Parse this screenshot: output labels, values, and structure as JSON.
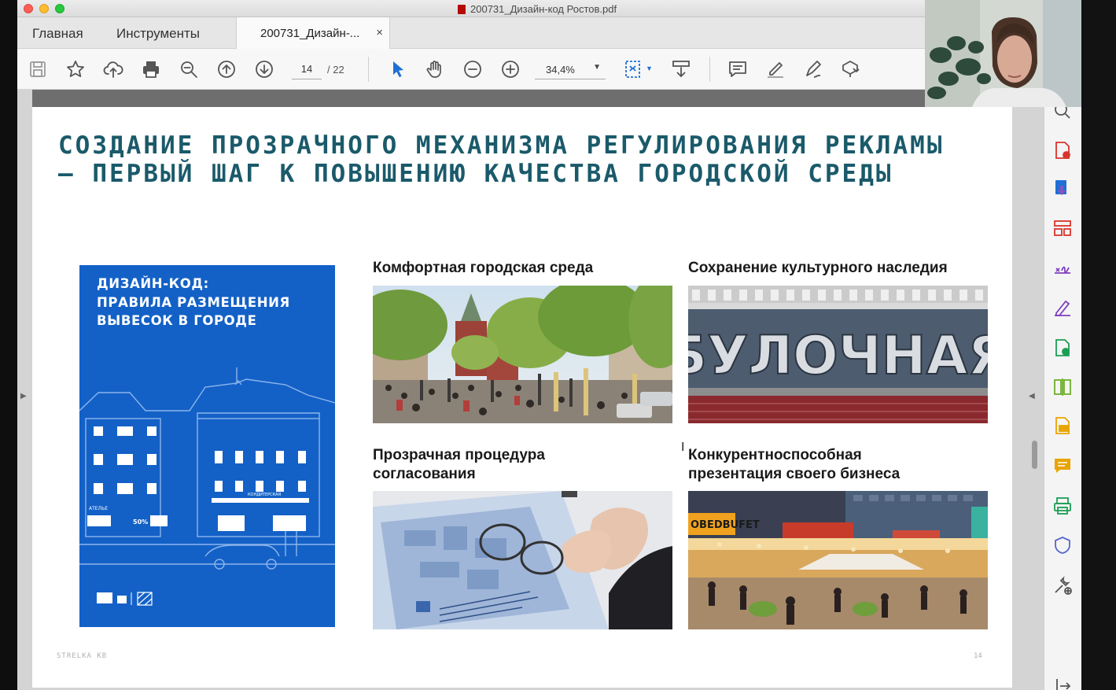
{
  "window": {
    "title": "200731_Дизайн-код Ростов.pdf"
  },
  "tabs": {
    "home": "Главная",
    "tools": "Инструменты",
    "document": "200731_Дизайн-...",
    "close": "×"
  },
  "toolbar": {
    "page_current": "14",
    "page_total": "/ 22",
    "zoom": "34,4%"
  },
  "slide": {
    "headline": "СОЗДАНИЕ ПРОЗРАЧНОГО МЕХАНИЗМА РЕГУЛИРОВАНИЯ РЕКЛАМЫ — ПЕРВЫЙ ШАГ К ПОВЫШЕНИЮ КАЧЕСТВА ГОРОДСКОЙ СРЕДЫ",
    "booklet_title": "ДИЗАЙН-КОД:\nПРАВИЛА РАЗМЕЩЕНИЯ\nВЫВЕСОК В ГОРОДЕ",
    "booklet_signs": {
      "atelier": "АТЕЛЬЕ",
      "sale": "50%",
      "confectionery": "КОНДИТЕРСКАЯ"
    },
    "captions": {
      "comfort": "Комфортная городская среда",
      "heritage": "Сохранение культурного наследия",
      "procedure": "Прозрачная процедура\nсогласования",
      "business": "Конкурентноспособная\nпрезентация своего бизнеса"
    },
    "photo_text": {
      "bakery_sign": "БУЛОЧНАЯ",
      "cafe_sign": "OBEDBUFET"
    },
    "footer_left": "STRELKA KB",
    "footer_right": "14"
  },
  "icons": {
    "toolbar": [
      "save-icon",
      "bookmark-star-icon",
      "upload-cloud-icon",
      "print-icon",
      "zoom-search-icon",
      "page-up-icon",
      "page-down-icon",
      "select-arrow-icon",
      "hand-tool-icon",
      "zoom-out-icon",
      "zoom-in-icon",
      "page-fit-icon",
      "scroll-mode-icon",
      "comment-icon",
      "highlight-pen-icon",
      "sign-icon",
      "stamp-tools-icon"
    ],
    "sidebar": [
      "search-icon",
      "create-pdf-icon",
      "export-pdf-icon",
      "organize-pages-icon",
      "fill-sign-icon",
      "edit-pdf-icon",
      "combine-files-icon",
      "compare-icon",
      "redact-icon",
      "comment-icon",
      "print-production-icon",
      "protect-icon",
      "more-tools-icon",
      "share-icon"
    ]
  },
  "colors": {
    "headline": "#1a5a6a",
    "booklet": "#1361c7",
    "sidebar_accent": "#d9342b",
    "blue_accent": "#1f6fd6"
  }
}
